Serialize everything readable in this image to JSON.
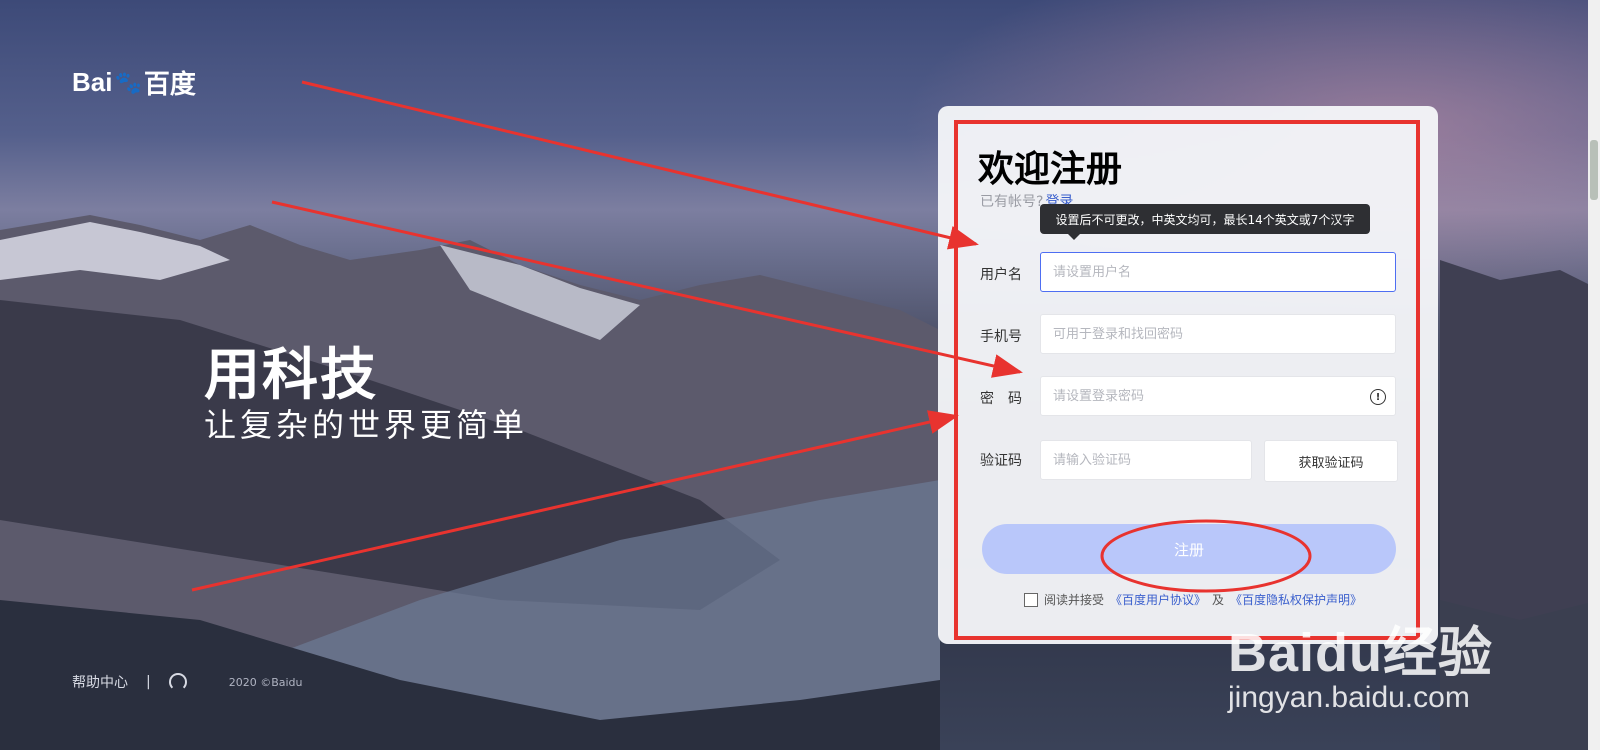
{
  "brand": {
    "logo_text_left": "Bai",
    "logo_text_right": "百度",
    "logo_du": "du"
  },
  "slogan": {
    "main": "用科技",
    "sub": "让复杂的世界更简单"
  },
  "footer": {
    "help": "帮助中心",
    "separator": "|",
    "copyright": "2020 ©Baidu"
  },
  "register": {
    "title": "欢迎注册",
    "have_account": "已有帐号?",
    "login_link": "登录",
    "tooltip": "设置后不可更改，中英文均可，最长14个英文或7个汉字",
    "username_label": "用户名",
    "username_placeholder": "请设置用户名",
    "phone_label": "手机号",
    "phone_placeholder": "可用于登录和找回密码",
    "password_label": "密　码",
    "password_placeholder": "请设置登录密码",
    "code_label": "验证码",
    "code_placeholder": "请输入验证码",
    "get_code": "获取验证码",
    "submit": "注册",
    "agree_prefix": "阅读并接受",
    "agreement_link": "《百度用户协议》",
    "agree_and": "及",
    "privacy_link": "《百度隐私权保护声明》"
  },
  "watermark": {
    "main": "Baidu经验",
    "sub": "jingyan.baidu.com"
  },
  "colors": {
    "annotation_red": "#e8332f",
    "accent_blue": "#4e6ef2",
    "button_blue": "#b9c7fa"
  }
}
